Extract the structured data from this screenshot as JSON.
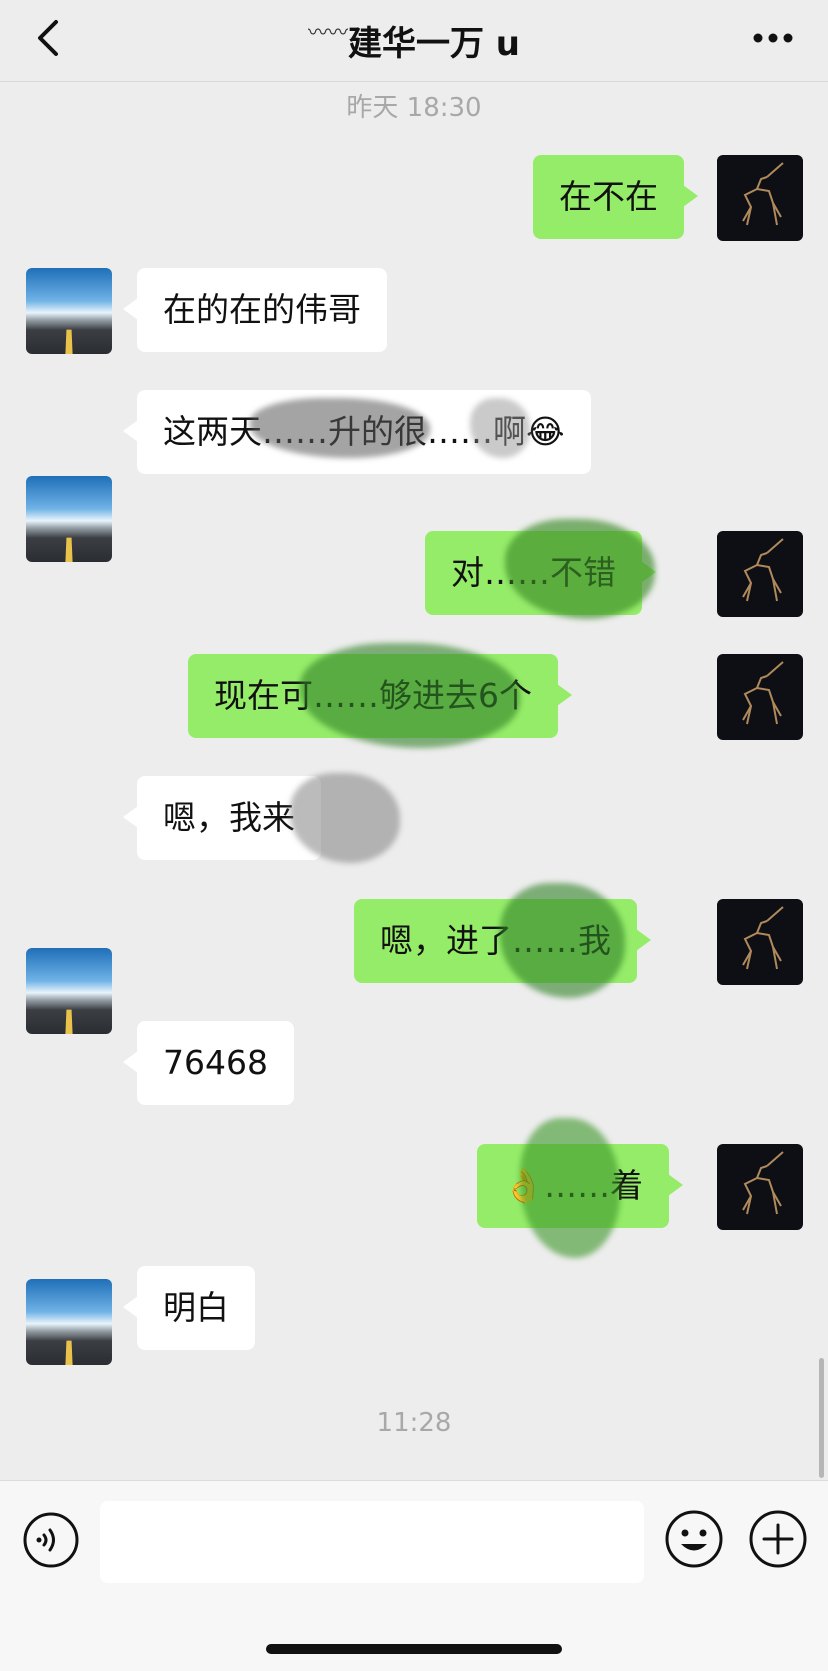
{
  "header": {
    "title_decoration": "〰〰",
    "title": "建华一万 u",
    "back_icon": "chevron-left-icon",
    "more_icon": "more-dots-icon"
  },
  "chat": {
    "timestamps": [
      "昨天 18:30",
      "11:28"
    ],
    "messages": [
      {
        "side": "right",
        "text": "在不在"
      },
      {
        "side": "left",
        "text": "在的在的伟哥"
      },
      {
        "side": "left",
        "text": "这两天……升的很……啊😂"
      },
      {
        "side": "right",
        "text": "对……不错"
      },
      {
        "side": "right",
        "text": "现在可……够进去6个"
      },
      {
        "side": "left",
        "text": "嗯，我来"
      },
      {
        "side": "right",
        "text": "嗯，进了……我"
      },
      {
        "side": "left",
        "text": "76468"
      },
      {
        "side": "right",
        "text": "👌……着"
      },
      {
        "side": "left",
        "text": "明白"
      }
    ]
  },
  "inputbar": {
    "input_value": "",
    "voice_icon": "voice-icon",
    "emoji_icon": "emoji-icon",
    "plus_icon": "plus-icon"
  },
  "colors": {
    "background": "#ededed",
    "bubble_self": "#95ec69",
    "bubble_other": "#ffffff",
    "timestamp": "#a8a8a8"
  }
}
